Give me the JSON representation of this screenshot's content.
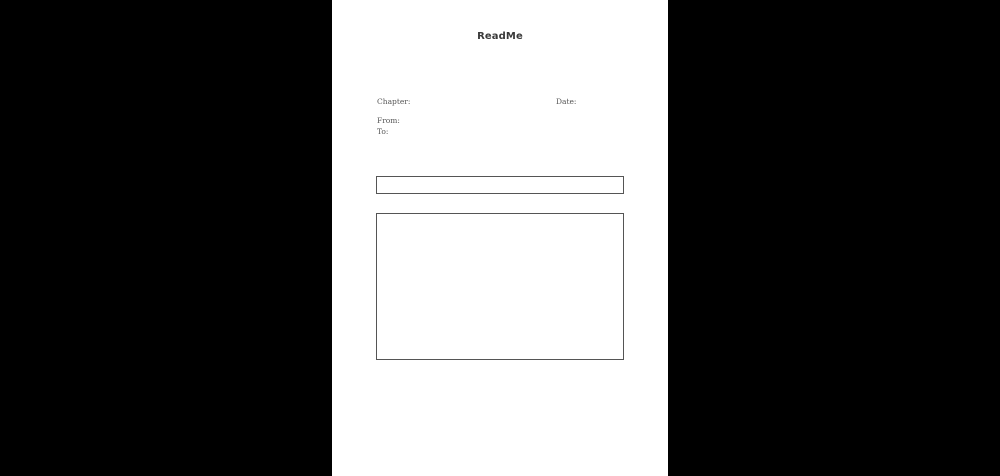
{
  "document": {
    "title": "ReadMe",
    "fields": {
      "chapter_label": "Chapter:",
      "date_label": "Date:",
      "from_label": "From:",
      "to_label": "To:"
    },
    "subject_value": "",
    "body_value": ""
  },
  "colors": {
    "background": "#000000",
    "page": "#ffffff",
    "text": "#3a3a3a",
    "border": "#555555"
  }
}
